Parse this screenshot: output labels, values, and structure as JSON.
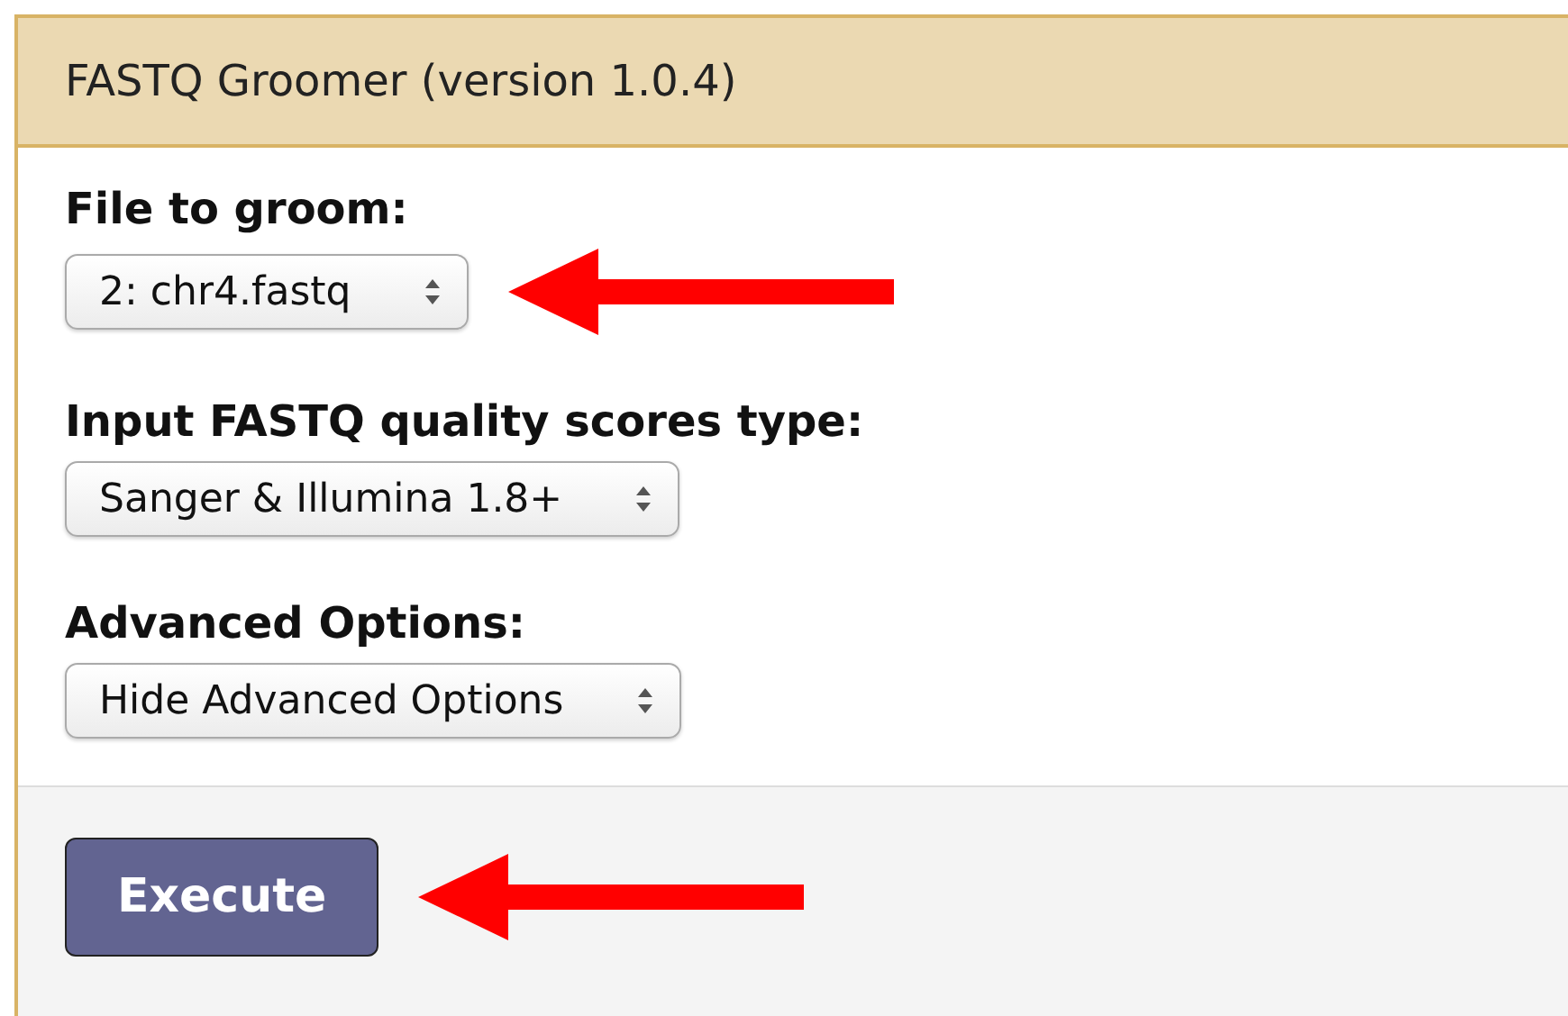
{
  "panel": {
    "title": "FASTQ Groomer (version 1.0.4)"
  },
  "fields": [
    {
      "label": "File to groom:",
      "value": "2: chr4.fastq",
      "arrow": true
    },
    {
      "label": "Input FASTQ quality scores type:",
      "value": "Sanger & Illumina 1.8+",
      "arrow": false
    },
    {
      "label": "Advanced Options:",
      "value": "Hide Advanced Options",
      "arrow": false
    }
  ],
  "execute_button": {
    "label": "Execute",
    "arrow": true
  }
}
